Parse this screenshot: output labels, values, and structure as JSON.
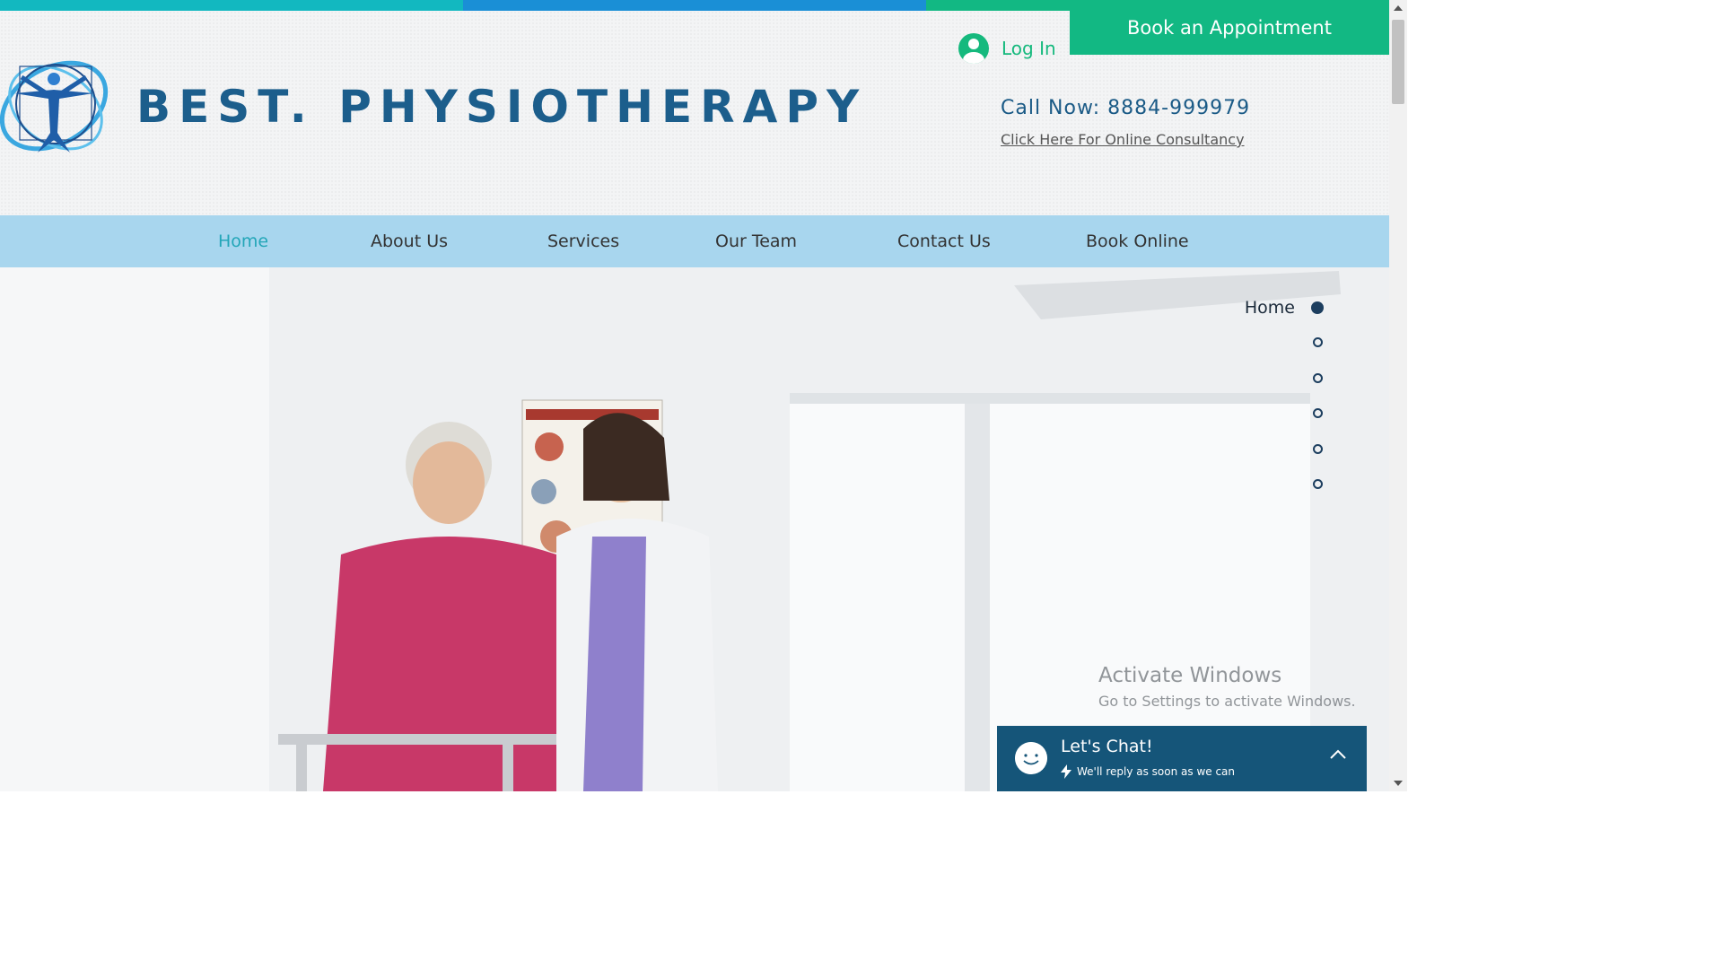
{
  "colors": {
    "stripe": [
      "#12b8c0",
      "#1a8fd6",
      "#12b883"
    ],
    "brand": "#1c5e8c",
    "accent_green": "#12b883",
    "nav_bg": "#a8d6ee",
    "nav_active": "#23a6b8",
    "chat_bg": "#155579"
  },
  "header": {
    "brand_name": "BEST. PHYSIOTHERAPY",
    "logo_icon": "vitruvian-man-logo-icon",
    "login_label": "Log In",
    "book_button": "Book an Appointment",
    "call_now": "Call Now: 8884-999979",
    "consult_link": "Click Here For Online Consultancy"
  },
  "nav": {
    "items": [
      {
        "label": "Home",
        "active": true
      },
      {
        "label": "About Us",
        "active": false
      },
      {
        "label": "Services",
        "active": false
      },
      {
        "label": "Our Team",
        "active": false
      },
      {
        "label": "Contact Us",
        "active": false
      },
      {
        "label": "Book Online",
        "active": false
      }
    ]
  },
  "anchor_menu": {
    "active_label": "Home",
    "dots": 6
  },
  "watermark": {
    "line1": "Activate Windows",
    "line2": "Go to Settings to activate Windows."
  },
  "chat": {
    "title": "Let's Chat!",
    "subtitle": "We'll reply as soon as we can",
    "icon": "smiley-face-icon",
    "chevron_icon": "chevron-up-icon"
  }
}
